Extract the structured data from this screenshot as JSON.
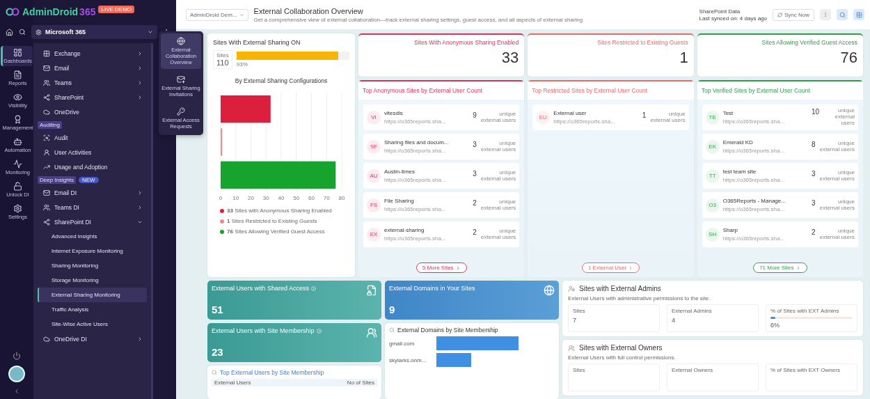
{
  "brand": {
    "name": "AdminDroid",
    "suffix": "365",
    "badge": "LIVE DEMO"
  },
  "tenant": {
    "label": "Microsoft 365"
  },
  "rail": [
    {
      "label": "Dashboards",
      "selected": true
    },
    {
      "label": "Reports",
      "selected": false
    },
    {
      "label": "Visibility",
      "selected": false
    },
    {
      "label": "Management",
      "selected": false
    },
    {
      "label": "Automation",
      "selected": false
    },
    {
      "label": "Monitoring",
      "selected": false
    },
    {
      "label": "Unlock DI",
      "selected": false
    },
    {
      "label": "Settings",
      "selected": false
    }
  ],
  "nav": [
    {
      "kind": "item",
      "label": "Exchange",
      "expandable": true,
      "expanded": false
    },
    {
      "kind": "item",
      "label": "Email",
      "expandable": true,
      "expanded": false
    },
    {
      "kind": "item",
      "label": "Teams",
      "expandable": true,
      "expanded": false
    },
    {
      "kind": "item",
      "label": "SharePoint",
      "expandable": true,
      "expanded": false
    },
    {
      "kind": "item",
      "label": "OneDrive",
      "expandable": false
    },
    {
      "kind": "section",
      "label": "Auditing"
    },
    {
      "kind": "item",
      "label": "Audit",
      "expandable": false
    },
    {
      "kind": "item",
      "label": "User Activities",
      "expandable": false
    },
    {
      "kind": "item",
      "label": "Usage and Adoption",
      "expandable": false
    },
    {
      "kind": "section",
      "label": "Deep Insights",
      "badge": "NEW"
    },
    {
      "kind": "item",
      "label": "Email DI",
      "expandable": true,
      "expanded": false
    },
    {
      "kind": "item",
      "label": "Teams DI",
      "expandable": true,
      "expanded": false
    },
    {
      "kind": "item",
      "label": "SharePoint DI",
      "expandable": true,
      "expanded": true,
      "children": [
        {
          "label": "Advanced Insights",
          "selected": false
        },
        {
          "label": "Internet Exposure Monitoring",
          "selected": false
        },
        {
          "label": "Sharing Monitoring",
          "selected": false
        },
        {
          "label": "Storage Monitoring",
          "selected": false
        },
        {
          "label": "External Sharing Monitoring",
          "selected": true
        },
        {
          "label": "Traffic Analysis",
          "selected": false
        },
        {
          "label": "Site-Wise Active Users",
          "selected": false
        }
      ]
    },
    {
      "kind": "item",
      "label": "OneDrive DI",
      "expandable": true,
      "expanded": false
    }
  ],
  "flyout": [
    {
      "label": "External Collaboration Overview",
      "selected": true
    },
    {
      "label": "External Sharing Invitations",
      "selected": false
    },
    {
      "label": "External Access Requests",
      "selected": false
    }
  ],
  "header": {
    "breadcrumb": "AdminDroid Dem...",
    "title": "External Collaboration Overview",
    "subtitle": "Get a comprehensive view of external collaboration—track external sharing settings, guest access, and all aspects of external sharing",
    "source": "SharePoint Data",
    "synced": "Last synced on: 4 days ago",
    "sync_button": "Sync Now"
  },
  "sharing": {
    "title": "Sites With External Sharing ON",
    "sites_label": "Sites",
    "sites_value": "110",
    "level": 0.9,
    "reading": "93%",
    "chart_title": "By External Sharing Configurations",
    "chart_data": {
      "type": "bar",
      "orientation": "horizontal",
      "stacked": true,
      "grid": true,
      "series": [
        {
          "name": "Sites with Anonymous Sharing Enabled",
          "color": "#dc1f3c",
          "values": [
            33,
            null,
            null
          ]
        },
        {
          "name": "Sites Restricted to Existing Guests",
          "color": "#f08a8a",
          "values": [
            null,
            1,
            null
          ]
        },
        {
          "name": "Sites Allowing Verified Guest Access",
          "color": "#17a42e",
          "values": [
            null,
            null,
            76
          ]
        }
      ],
      "xlim": [
        0,
        80
      ],
      "xticks": [
        0,
        10,
        20,
        30,
        40,
        50,
        60,
        70,
        80
      ]
    },
    "legend_values": [
      "33",
      "1",
      "76"
    ]
  },
  "columns": [
    {
      "stat_title": "Sites With Anonymous Sharing Enabled",
      "stat_value": "33",
      "color": "#e0315a",
      "list_title": "Top Anonymous Sites by External User Count",
      "more": "5 More Sites",
      "sites": [
        {
          "initials": "VI",
          "name": "vitesdls",
          "url": "https://o365reports.sha...",
          "count": "9",
          "unit": "unique external users"
        },
        {
          "initials": "SF",
          "name": "Sharing files and docum...",
          "url": "https://o365reports.sha...",
          "count": "3",
          "unit": "unique external users"
        },
        {
          "initials": "AU",
          "name": "Austin-times",
          "url": "https://o365reports.sha...",
          "count": "3",
          "unit": "unique external users"
        },
        {
          "initials": "FS",
          "name": "File Sharing",
          "url": "https://o365reports.sha...",
          "count": "2",
          "unit": "unique external users"
        },
        {
          "initials": "EX",
          "name": "external-sharing",
          "url": "https://o365reports.sha...",
          "count": "2",
          "unit": "unique external users"
        }
      ]
    },
    {
      "stat_title": "Sites Restricted to Existing Guests",
      "stat_value": "1",
      "color": "#ea6a6a",
      "list_title": "Top Restricted Sites by External User Count",
      "more": "1 External User",
      "sites": [
        {
          "initials": "EU",
          "name": "External user",
          "url": "https://o365reports.sha...",
          "count": "1",
          "unit": "unique external users"
        }
      ]
    },
    {
      "stat_title": "Sites Allowing Verified Guest Access",
      "stat_value": "76",
      "color": "#2f9e4a",
      "list_title": "Top Verified Sites by External User Count",
      "more": "71 More Sites",
      "sites": [
        {
          "initials": "TE",
          "name": "Test",
          "url": "https://o365reports.sha...",
          "count": "10",
          "unit": "unique external users"
        },
        {
          "initials": "EK",
          "name": "Emerald KD",
          "url": "https://o365reports.sha...",
          "count": "8",
          "unit": "unique external users"
        },
        {
          "initials": "TT",
          "name": "test team site",
          "url": "https://o365reports.sha...",
          "count": "3",
          "unit": "unique external users"
        },
        {
          "initials": "O3",
          "name": "O365Reports - Manage...",
          "url": "https://o365reports.sha...",
          "count": "3",
          "unit": "unique external users"
        },
        {
          "initials": "SH",
          "name": "Sharp",
          "url": "https://o365reports.sha...",
          "count": "2",
          "unit": "unique external users"
        }
      ]
    }
  ],
  "user_cards": [
    {
      "title": "External Users with Shared Access",
      "value": "51"
    },
    {
      "title": "External Users with Site Membership",
      "value": "23"
    }
  ],
  "top_users": {
    "title": "Top External Users by Site Membership",
    "columns": [
      "External Users",
      "No of Sites"
    ]
  },
  "domains": {
    "title": "External Domains in Your Sites",
    "value": "9",
    "chart_title": "External Domains by Site Membership",
    "items": [
      "gmail.com",
      "skylarks.onm..."
    ]
  },
  "admin_cards": [
    {
      "title": "Sites with External Admins",
      "description": "External Users with administrative permissions to the site.",
      "stats": [
        {
          "label": "Sites",
          "value": "7"
        },
        {
          "label": "External Admins",
          "value": "4"
        }
      ],
      "percent": {
        "label": "% of Sites with EXT Admins",
        "level": 0.06,
        "reading": "6%"
      }
    },
    {
      "title": "Sites with External Owners",
      "description": "External Users with full control permissions.",
      "stats": [
        {
          "label": "Sites"
        },
        {
          "label": "External Owners"
        }
      ],
      "percent": {
        "label": "% of Sites with EXT Owners"
      }
    }
  ]
}
